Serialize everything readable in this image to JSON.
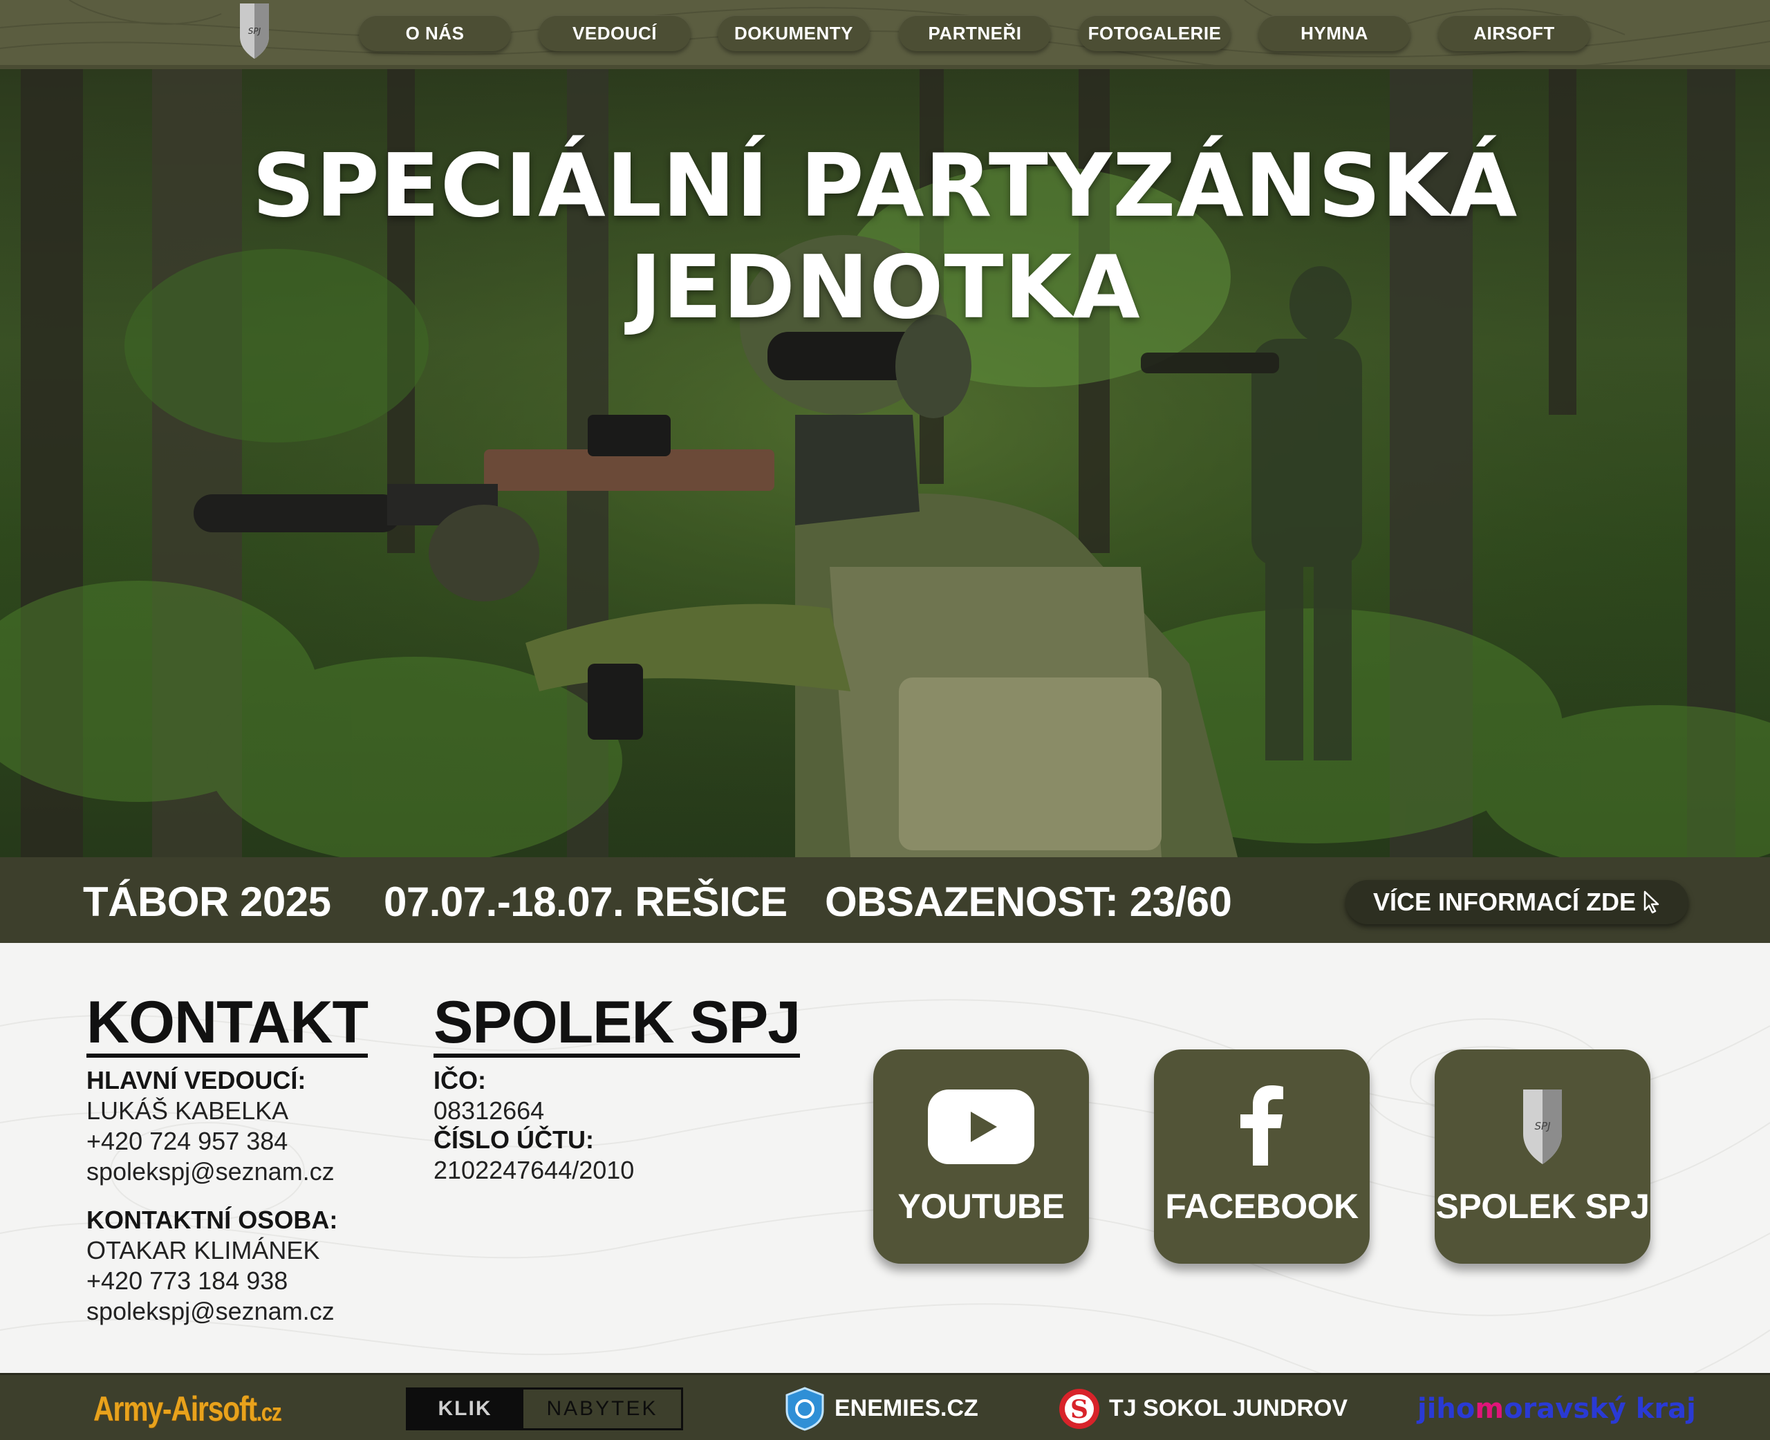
{
  "nav": {
    "items": [
      "O NÁS",
      "VEDOUCÍ",
      "DOKUMENTY",
      "PARTNEŘI",
      "FOTOGALERIE",
      "HYMNA",
      "AIRSOFT"
    ],
    "logo_text": "SPJ"
  },
  "hero": {
    "title": "SPECIÁLNÍ PARTYZÁNSKÁ JEDNOTKA"
  },
  "info_bar": {
    "camp": "TÁBOR 2025",
    "dates_place": "07.07.-18.07. REŠICE",
    "occupancy": "OBSAZENOST: 23/60",
    "button_label": "VÍCE INFORMACÍ ZDE"
  },
  "contact": {
    "title": "KONTAKT",
    "head_leader_label": "HLAVNÍ VEDOUCÍ:",
    "head_leader_name": "LUKÁŠ KABELKA",
    "head_leader_phone": "+420 724 957 384",
    "head_leader_email": "spolekspj@seznam.cz",
    "contact_person_label": "KONTAKTNÍ OSOBA:",
    "contact_person_name": "OTAKAR KLIMÁNEK",
    "contact_person_phone": "+420 773 184 938",
    "contact_person_email": "spolekspj@seznam.cz"
  },
  "association": {
    "title": "SPOLEK SPJ",
    "ico_label": "IČO:",
    "ico_value": "08312664",
    "account_label": "ČÍSLO ÚČTU:",
    "account_value": "2102247644/2010"
  },
  "social": [
    {
      "label": "YOUTUBE",
      "icon": "youtube-icon"
    },
    {
      "label": "FACEBOOK",
      "icon": "facebook-icon"
    },
    {
      "label": "SPOLEK SPJ",
      "icon": "spj-shield-icon"
    }
  ],
  "partners": {
    "army_airsoft_main": "Army-Airsoft",
    "army_airsoft_tld": ".cz",
    "klik": "KLIK",
    "nabytek": "NABYTEK",
    "enemies": "ENEMIES.CZ",
    "sokol": "TJ SOKOL JUNDROV",
    "jmk_a": "jiho",
    "jmk_b": "m",
    "jmk_c": "oravský kraj"
  },
  "colors": {
    "olive": "#5b5d40",
    "dark_olive": "#3d3f2c",
    "tile": "#525437",
    "army_airsoft_orange": "#e8a21c",
    "sokol_red": "#d8232a",
    "jmk_blue": "#2a3ad4",
    "jmk_pink": "#e0157a"
  }
}
